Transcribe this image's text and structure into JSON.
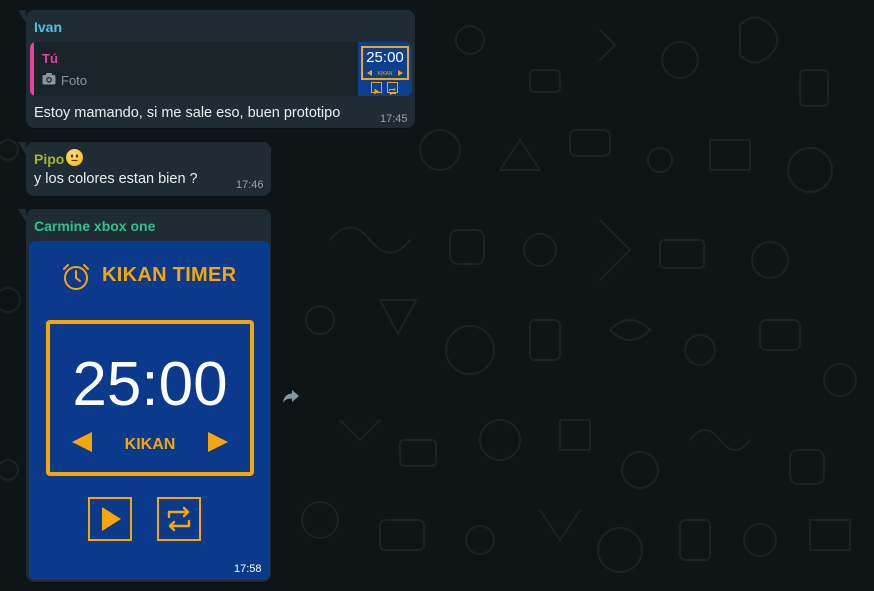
{
  "theme": {
    "background": "#0f1416",
    "bubble": "#202c33",
    "timer_blue": "#0b3a8c",
    "timer_orange": "#f5a70a"
  },
  "messages": [
    {
      "sender": "Ivan",
      "sender_color": "#53bdeb",
      "quoted": {
        "sender": "Tú",
        "sender_color": "#e542a3",
        "icon": "camera-icon",
        "label": "Foto",
        "thumbnail": {
          "time": "25:00",
          "mode": "KIKAN"
        }
      },
      "text": "Estoy mamando, si me sale eso, buen prototipo",
      "time": "17:45"
    },
    {
      "sender": "Pipo",
      "sender_color": "#a5b337",
      "emoji": "neutral-face-emoji",
      "text": "y los colores estan bien ?",
      "time": "17:46"
    },
    {
      "sender": "Carmine xbox one",
      "sender_color": "#2bc48a",
      "image": {
        "app_title": "KIKAN TIMER",
        "time": "25:00",
        "mode": "KIKAN",
        "icons": [
          "stopwatch-icon",
          "arrow-left-icon",
          "arrow-right-icon",
          "play-icon",
          "repeat-icon"
        ]
      },
      "time": "17:58"
    }
  ],
  "forward_icon": "forward-icon"
}
